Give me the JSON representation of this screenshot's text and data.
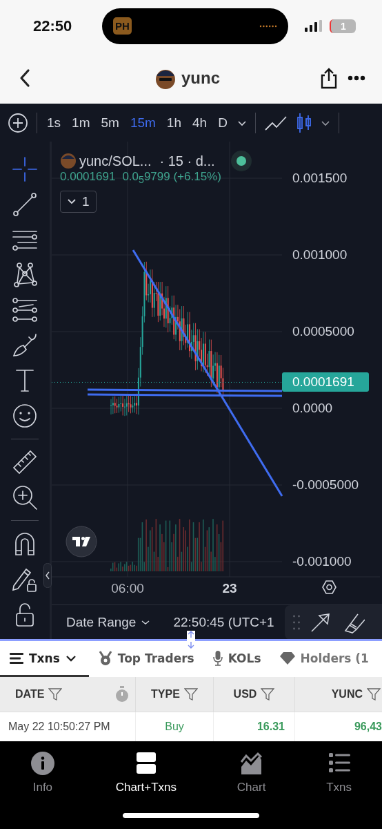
{
  "status_bar": {
    "time": "22:50",
    "island_app": "PH",
    "battery": "1"
  },
  "header": {
    "title": "yunc"
  },
  "intervals": [
    {
      "label": "1s",
      "selected": false
    },
    {
      "label": "1m",
      "selected": false
    },
    {
      "label": "5m",
      "selected": false
    },
    {
      "label": "15m",
      "selected": true
    },
    {
      "label": "1h",
      "selected": false
    },
    {
      "label": "4h",
      "selected": false
    },
    {
      "label": "D",
      "selected": false
    }
  ],
  "chart_types": [
    {
      "kind": "line",
      "selected": false
    },
    {
      "kind": "candles",
      "selected": true
    }
  ],
  "tools": [
    {
      "kind": "crosshair",
      "selected": true
    },
    {
      "kind": "trend-line",
      "selected": false
    },
    {
      "kind": "parallel-lines",
      "selected": false
    },
    {
      "kind": "pattern",
      "selected": false
    },
    {
      "kind": "fib",
      "selected": false
    },
    {
      "kind": "brush",
      "selected": false
    },
    {
      "kind": "text",
      "selected": false
    },
    {
      "kind": "emoji",
      "selected": false
    },
    {
      "kind": "divider"
    },
    {
      "kind": "ruler",
      "selected": false
    },
    {
      "kind": "zoom",
      "selected": false
    },
    {
      "kind": "divider"
    },
    {
      "kind": "magnet",
      "selected": false
    },
    {
      "kind": "lock-drawing",
      "selected": false
    },
    {
      "kind": "lock",
      "selected": false
    }
  ],
  "legend": {
    "symbol": "yunc/SOL...",
    "interval": "· 15 · d...",
    "price": "0.0001691",
    "change": "0.0$_{5}$9799 (+6.15%)",
    "studies_count": "1"
  },
  "price_axis": [
    "0.001500",
    "0.001000",
    "0.0005000",
    "0.0000",
    "-0.0005000",
    "-0.001000"
  ],
  "last_price": "0.0001691",
  "time_axis": [
    {
      "label": "06:00",
      "bold": false
    },
    {
      "label": "23",
      "bold": true
    }
  ],
  "bottom_bar": {
    "date_range": "Date Range",
    "clock": "22:50:45 (UTC+1"
  },
  "tabs": [
    {
      "label": "Txns",
      "selected": true,
      "kind": "menu"
    },
    {
      "label": "Top Traders",
      "selected": false,
      "kind": "medal"
    },
    {
      "label": "KOLs",
      "selected": false,
      "kind": "mic"
    },
    {
      "label": "Holders (1",
      "selected": false,
      "kind": "gem"
    }
  ],
  "table": {
    "columns": [
      {
        "label": "DATE",
        "timer": true
      },
      {
        "label": "TYPE",
        "timer": false
      },
      {
        "label": "USD",
        "timer": false
      },
      {
        "label": "YUNC",
        "timer": false
      }
    ],
    "rows": [
      {
        "date": "May 22 10:50:27 PM",
        "type": "Buy",
        "usd": "16.31",
        "amount": "96,43"
      }
    ]
  },
  "nav": [
    {
      "label": "Info",
      "selected": false,
      "kind": "info"
    },
    {
      "label": "Chart+Txns",
      "selected": true,
      "kind": "split"
    },
    {
      "label": "Chart",
      "selected": false,
      "kind": "chart"
    },
    {
      "label": "Txns",
      "selected": false,
      "kind": "list"
    }
  ]
}
